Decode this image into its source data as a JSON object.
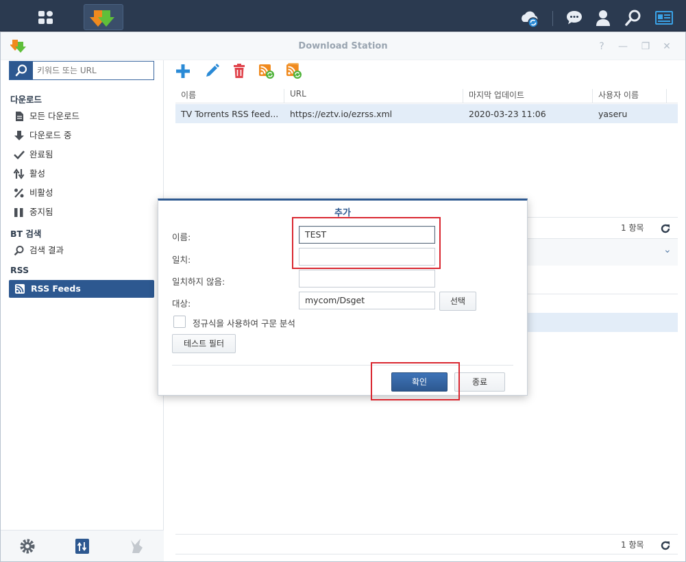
{
  "window": {
    "title": "Download Station"
  },
  "sidebar": {
    "search_placeholder": "키워드 또는 URL",
    "sections": {
      "download": "다운로드",
      "bt_search": "BT 검색",
      "rss": "RSS"
    },
    "items": [
      {
        "label": "모든 다운로드",
        "icon": "document-icon"
      },
      {
        "label": "다운로드 중",
        "icon": "arrow-down-icon"
      },
      {
        "label": "완료됨",
        "icon": "check-icon"
      },
      {
        "label": "활성",
        "icon": "updown-arrows-icon"
      },
      {
        "label": "비활성",
        "icon": "percent-slash-icon"
      },
      {
        "label": "중지됨",
        "icon": "pause-icon"
      },
      {
        "label": "검색 결과",
        "icon": "search-icon"
      },
      {
        "label": "RSS Feeds",
        "icon": "rss-icon"
      }
    ]
  },
  "grid": {
    "columns": [
      "이름",
      "URL",
      "마지막 업데이트",
      "사용자 이름"
    ],
    "rows": [
      {
        "name": "TV Torrents RSS feed...",
        "url": "https://eztv.io/ezrss.xml",
        "updated": "2020-03-23 11:06",
        "user": "yaseru"
      }
    ],
    "count_top": "1 항목",
    "count_bottom": "1 항목"
  },
  "modal": {
    "title": "추가",
    "fields": {
      "name_label": "이름:",
      "name_value": "TEST",
      "match_label": "일치:",
      "match_value": "",
      "nomatch_label": "일치하지 않음:",
      "nomatch_value": "",
      "dest_label": "대상:",
      "dest_value": "mycom/Dsget"
    },
    "select_button": "선택",
    "regex_checkbox_label": "정규식을 사용하여 구문 분석",
    "test_filter_button": "테스트 필터",
    "ok_button": "확인",
    "close_button": "종료"
  },
  "colors": {
    "taskbar": "#2b3a50",
    "accent": "#2d5890",
    "highlight": "#d9262f",
    "selected_row": "#e3edf8"
  }
}
